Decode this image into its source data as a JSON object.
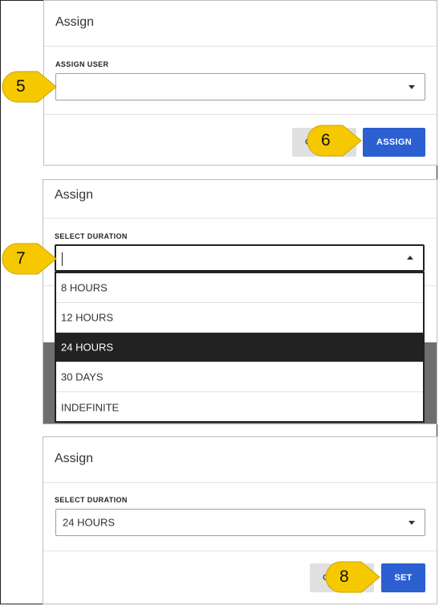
{
  "panel1": {
    "title": "Assign",
    "field_label": "ASSIGN USER",
    "select_value": "",
    "cancel_label": "C",
    "assign_label": "ASSIGN"
  },
  "panel2": {
    "title": "Assign",
    "field_label": "SELECT DURATION",
    "options": [
      "8 HOURS",
      "12 HOURS",
      "24 HOURS",
      "30 DAYS",
      "INDEFINITE"
    ],
    "highlighted_option": "24 HOURS"
  },
  "panel3": {
    "title": "Assign",
    "field_label": "SELECT DURATION",
    "select_value": "24 HOURS",
    "cancel_label": "C",
    "set_label": "SET"
  },
  "callouts": {
    "c5": "5",
    "c6": "6",
    "c7": "7",
    "c8": "8"
  },
  "colors": {
    "primary": "#2c5fd0",
    "callout": "#f6c800",
    "selected_option_bg": "#222222"
  }
}
